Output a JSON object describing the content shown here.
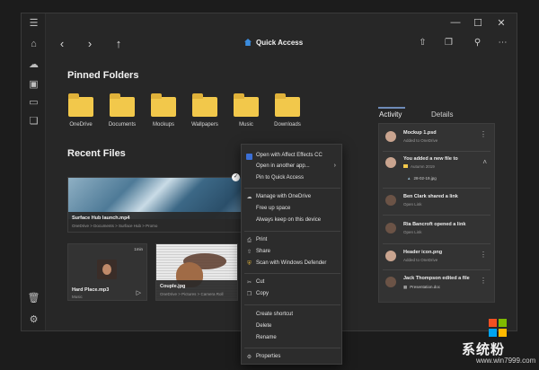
{
  "window": {
    "title": "Quick Access",
    "rail_icons": [
      "menu-icon",
      "home-icon",
      "cloud-icon",
      "pc-icon",
      "drive-icon",
      "photos-icon",
      "trash-icon",
      "settings-icon"
    ]
  },
  "toolbar": {
    "nav_icons": [
      "back-arrow-icon",
      "forward-arrow-icon",
      "up-arrow-icon"
    ],
    "right_icons": [
      "share-icon",
      "copy-icon",
      "search-icon",
      "more-icon"
    ]
  },
  "pinned": {
    "heading": "Pinned Folders",
    "folders": [
      {
        "label": "OneDrive"
      },
      {
        "label": "Documents"
      },
      {
        "label": "Mockups"
      },
      {
        "label": "Wallpapers"
      },
      {
        "label": "Music"
      },
      {
        "label": "Downloads"
      }
    ]
  },
  "recent": {
    "heading": "Recent Files",
    "files": [
      {
        "name": "Surface Hub launch.mp4",
        "path": "OneDrive > Documents > Surface Hub > Promo"
      },
      {
        "name": "Hard Place.mp3",
        "path": "Music",
        "badge": "1min"
      },
      {
        "name": "Couple.jpg",
        "path": "OneDrive > Pictures > Camera Roll"
      }
    ]
  },
  "context_menu": {
    "items": [
      {
        "label": "Open with Affect Effects CC",
        "icon": "app-icon"
      },
      {
        "label": "Open in another app...",
        "icon": "",
        "submenu": true
      },
      {
        "label": "Pin to Quick Access",
        "icon": ""
      },
      {
        "label": "Manage with OneDrive",
        "icon": "cloud-icon"
      },
      {
        "label": "Free up space",
        "icon": ""
      },
      {
        "label": "Always keep on this device",
        "icon": ""
      },
      {
        "label": "Print",
        "icon": "print-icon"
      },
      {
        "label": "Share",
        "icon": "share-icon"
      },
      {
        "label": "Scan with Windows Defender",
        "icon": "shield-icon"
      },
      {
        "label": "Cut",
        "icon": "scissors-icon"
      },
      {
        "label": "Copy",
        "icon": "copy-icon"
      },
      {
        "label": "Create shortcut",
        "icon": ""
      },
      {
        "label": "Delete",
        "icon": ""
      },
      {
        "label": "Rename",
        "icon": ""
      },
      {
        "label": "Properties",
        "icon": "properties-icon"
      }
    ]
  },
  "panel": {
    "tabs": [
      {
        "label": "Activity"
      },
      {
        "label": "Details"
      }
    ],
    "activity": [
      {
        "title": "Mockup 1.psd",
        "sub": "Added to OneDrive"
      },
      {
        "title": "You added a new file to",
        "sub": "Autumn 2019",
        "file": "28-02-19.jpg"
      },
      {
        "title": "Ben Clark shared a link",
        "sub": "Open Link"
      },
      {
        "title": "Ria Bancroft opened a link",
        "sub": "Open Link"
      },
      {
        "title": "Header icon.png",
        "sub": "Added to OneDrive"
      },
      {
        "title": "Jack Thompson edited a file",
        "sub": "Presentation.doc"
      }
    ]
  },
  "watermark": {
    "text": "系统粉",
    "url": "www.win7999.com"
  },
  "colors": {
    "folder": "#f2c84b",
    "accent": "#3b8cde",
    "tab_underline": "#6e8bb8"
  }
}
